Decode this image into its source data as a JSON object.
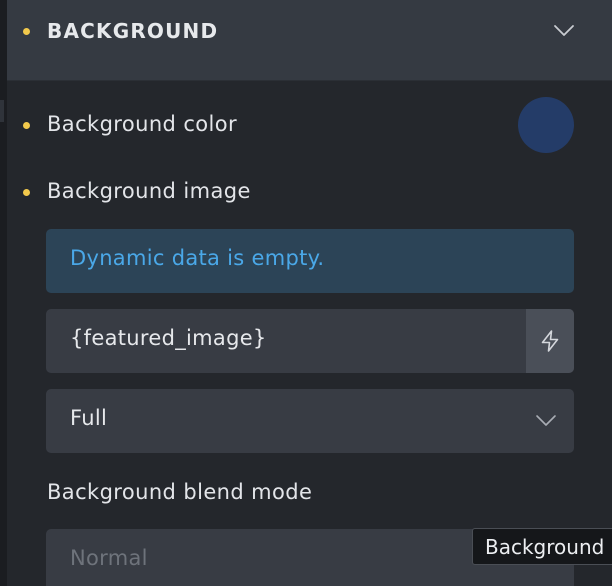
{
  "section": {
    "title": "BACKGROUND",
    "chevron_icon": "chevron-down-icon"
  },
  "background_color": {
    "label": "Background color",
    "swatch_color": "#243c68"
  },
  "background_image": {
    "label": "Background image",
    "notice": "Dynamic data is empty.",
    "value": "{featured_image}",
    "dynamic_icon": "lightning-icon",
    "size_select": "Full"
  },
  "blend_mode": {
    "label": "Background blend mode",
    "placeholder": "Normal"
  },
  "tooltip": {
    "text": "Background"
  },
  "colors": {
    "accent_dot": "#f2c94c",
    "notice_text": "#4aa8e8",
    "notice_bg": "#2c4457"
  }
}
